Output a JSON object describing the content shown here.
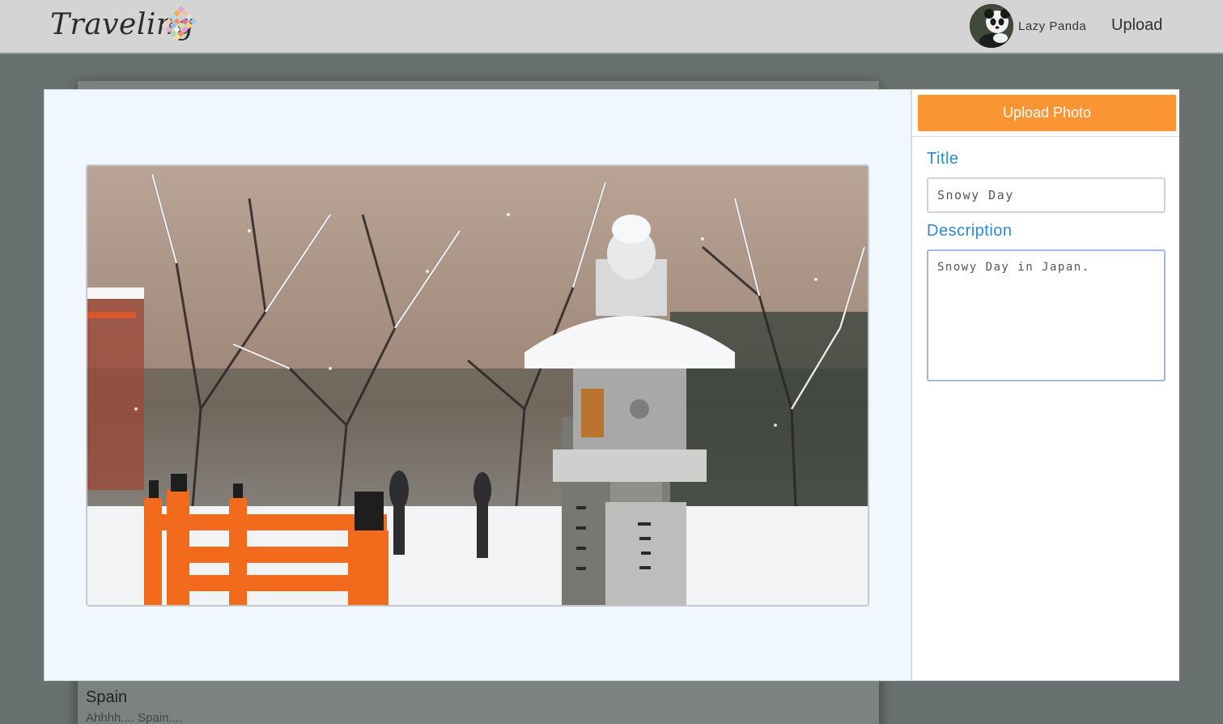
{
  "header": {
    "logo_text": "Traveling",
    "user_name": "Lazy Panda",
    "upload_link": "Upload"
  },
  "background_card": {
    "title": "Spain",
    "description": "Ahhhh.... Spain...."
  },
  "upload_panel": {
    "button_label": "Upload Photo",
    "title_label": "Title",
    "title_value": "Snowy Day",
    "description_label": "Description",
    "description_value": "Snowy Day in Japan."
  },
  "colors": {
    "accent_orange": "#fb9433",
    "label_blue": "#2a8bd6",
    "navbar_bg": "#d4d4d4",
    "overlay_bg": "#687070"
  }
}
